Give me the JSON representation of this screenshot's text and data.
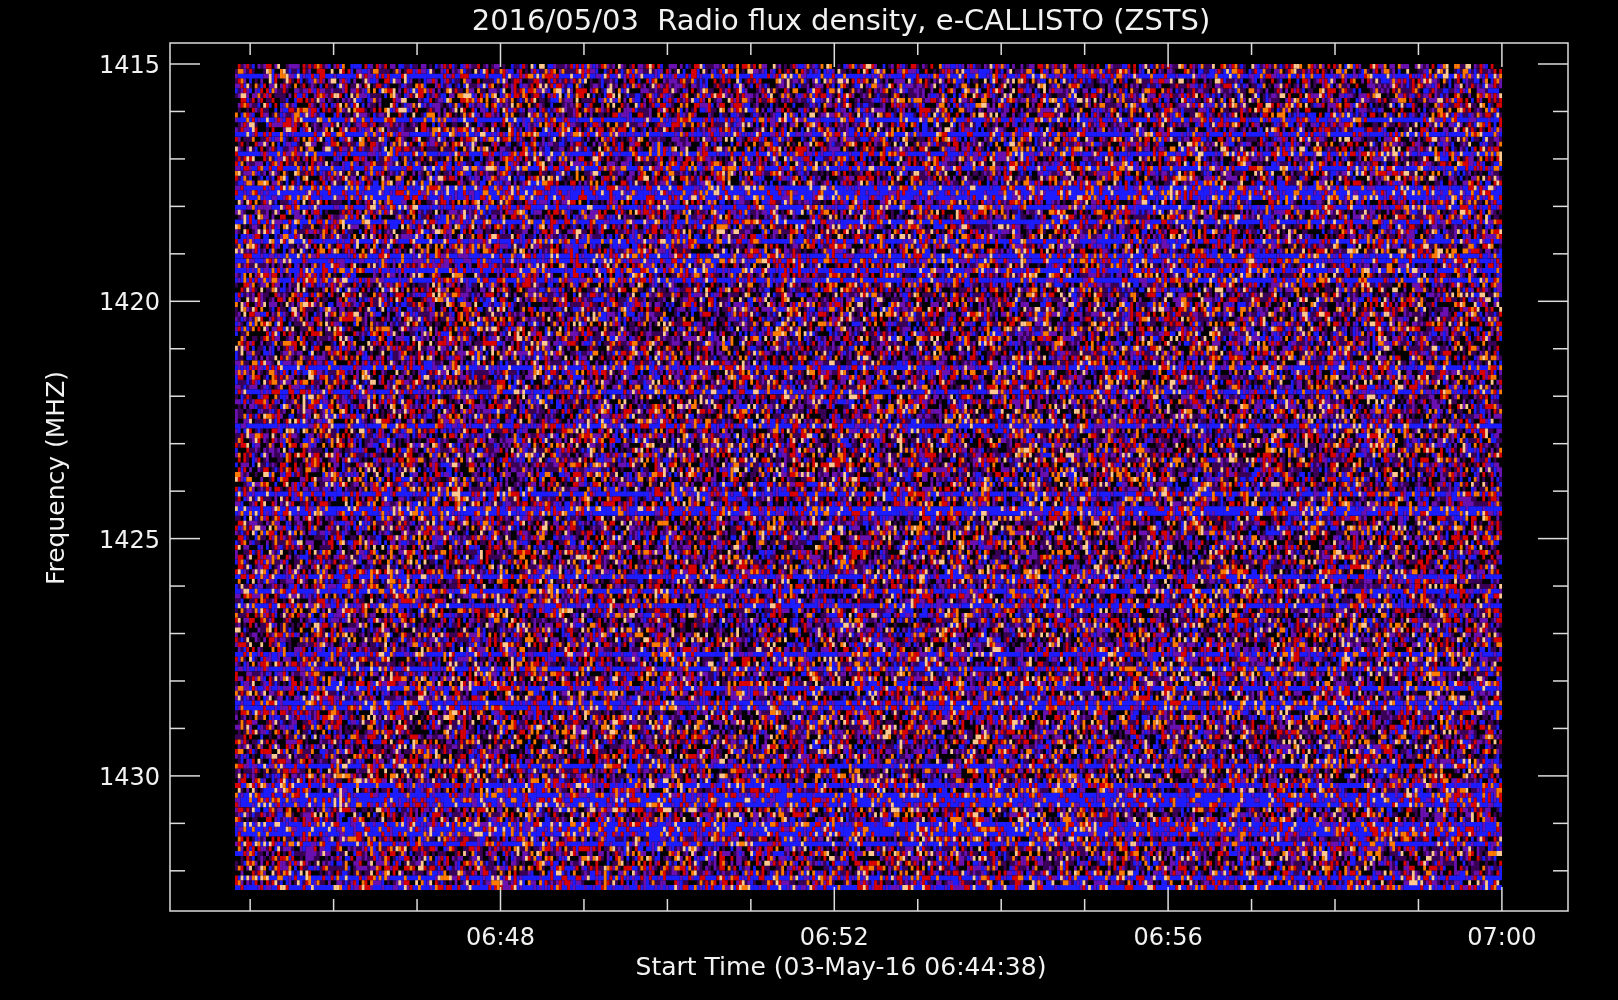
{
  "title": "2016/05/03  Radio flux density, e-CALLISTO (ZSTS)",
  "y_axis": {
    "label": "Frequency (MHZ)",
    "ticks": [
      "1415",
      "1420",
      "1425",
      "1430"
    ]
  },
  "x_axis": {
    "label": "Start Time (03-May-16 06:44:38)",
    "ticks": [
      "06:48",
      "06:52",
      "06:56",
      "07:00"
    ]
  }
}
